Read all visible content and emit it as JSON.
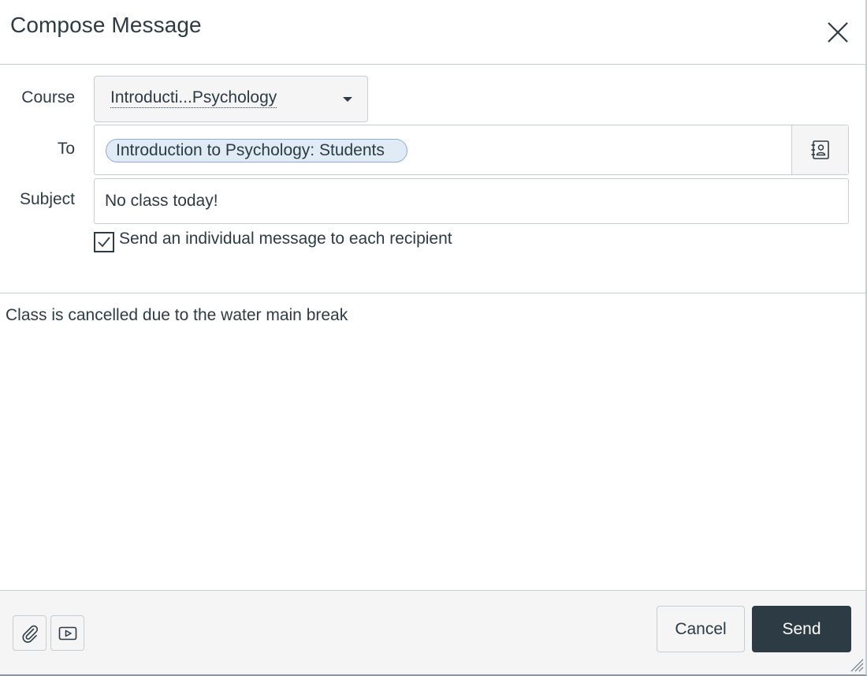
{
  "dialog": {
    "title": "Compose Message",
    "close_icon": "close-icon"
  },
  "form": {
    "course_label": "Course",
    "course_value": "Introducti...Psychology",
    "to_label": "To",
    "to_recipients": [
      "Introduction to Psychology: Students"
    ],
    "address_book_icon": "address-book-icon",
    "subject_label": "Subject",
    "subject_value": "No class today!",
    "individual_message_label": "Send an individual message to each recipient",
    "individual_message_checked": true
  },
  "body": {
    "text": "Class is cancelled due to the water main break"
  },
  "footer": {
    "attach_icon": "paperclip-icon",
    "media_icon": "media-icon",
    "cancel_label": "Cancel",
    "send_label": "Send"
  },
  "colors": {
    "text": "#2d3b45",
    "border": "#c7cdd1",
    "token_bg": "#e0ebf5",
    "token_border": "#8eaed0",
    "send_bg": "#2d3b45",
    "footer_bg": "#f5f5f5"
  }
}
